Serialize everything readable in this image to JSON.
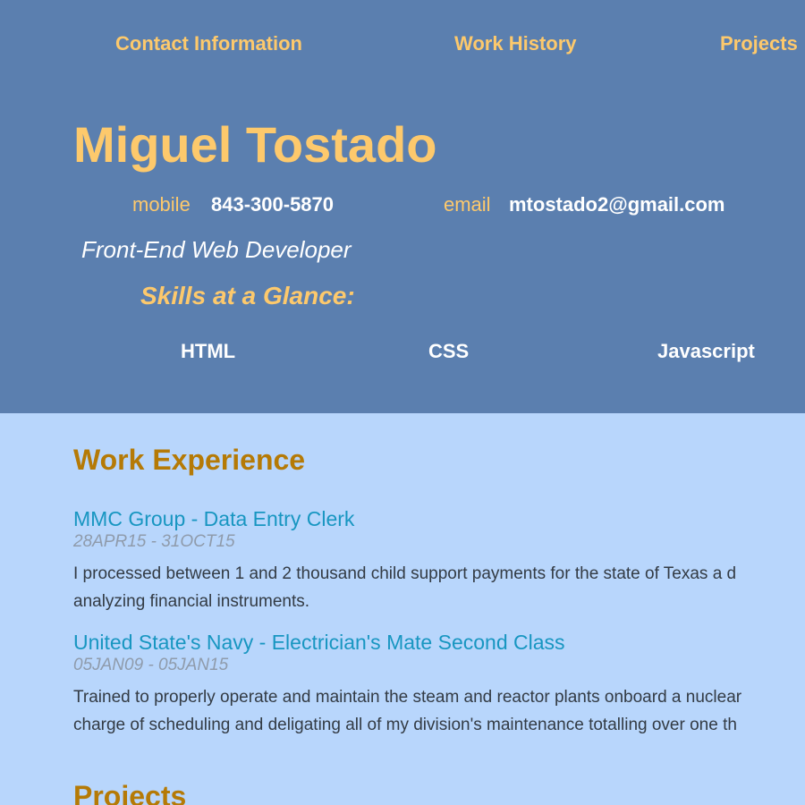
{
  "nav": {
    "items": [
      "Contact Information",
      "Work History",
      "Projects"
    ]
  },
  "header": {
    "name": "Miguel Tostado",
    "mobile_label": "mobile",
    "mobile_value": "843-300-5870",
    "email_label": "email",
    "email_value": "mtostado2@gmail.com",
    "role": "Front-End Web Developer",
    "skills_heading": "Skills at a Glance:",
    "skills": [
      "HTML",
      "CSS",
      "Javascript"
    ]
  },
  "work": {
    "heading": "Work Experience",
    "jobs": [
      {
        "title": "MMC Group - Data Entry Clerk",
        "dates": "28APR15 - 31OCT15",
        "desc_line1": "I processed between 1 and 2 thousand child support payments for the state of Texas a d",
        "desc_line2": "analyzing financial instruments."
      },
      {
        "title": "United State's Navy - Electrician's Mate Second Class",
        "dates": "05JAN09 - 05JAN15",
        "desc_line1": "Trained to properly operate and maintain the steam and reactor plants onboard a nuclear",
        "desc_line2": "charge of scheduling and deligating all of my division's maintenance totalling over one th"
      }
    ]
  },
  "projects": {
    "heading": "Projects"
  },
  "colors": {
    "header_bg": "#5b7faf",
    "page_bg": "#b8d6fc",
    "accent": "#fdc96c",
    "section_heading": "#b57a06",
    "job_title": "#1896c1"
  }
}
